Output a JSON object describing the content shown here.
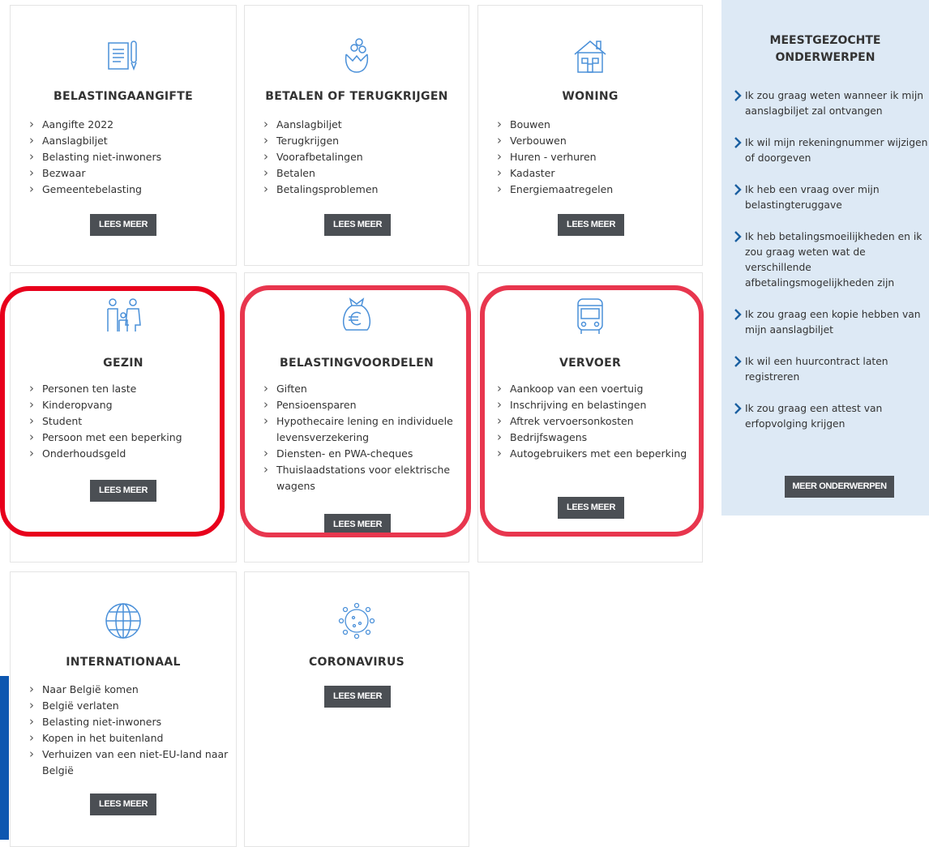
{
  "cards": [
    {
      "icon": "document-pen-icon",
      "title": "BELASTINGAANGIFTE",
      "items": [
        "Aangifte 2022",
        "Aanslagbiljet",
        "Belasting niet-inwoners",
        "Bezwaar",
        "Gemeentebelasting"
      ],
      "button": "LEES MEER"
    },
    {
      "icon": "money-bag-coins-icon",
      "title": "BETALEN OF TERUGKRIJGEN",
      "items": [
        "Aanslagbiljet",
        "Terugkrijgen",
        "Voorafbetalingen",
        "Betalen",
        "Betalingsproblemen"
      ],
      "button": "LEES MEER"
    },
    {
      "icon": "house-icon",
      "title": "WONING",
      "items": [
        "Bouwen",
        "Verbouwen",
        "Huren - verhuren",
        "Kadaster",
        "Energiemaatregelen"
      ],
      "button": "LEES MEER"
    },
    {
      "icon": "family-icon",
      "title": "GEZIN",
      "items": [
        "Personen ten laste",
        "Kinderopvang",
        "Student",
        "Persoon met een beperking",
        "Onderhoudsgeld"
      ],
      "button": "LEES MEER"
    },
    {
      "icon": "euro-bag-icon",
      "title": "BELASTINGVOORDELEN",
      "items": [
        "Giften",
        "Pensioensparen",
        "Hypothecaire lening en individuele levensverzekering",
        "Diensten- en PWA-cheques",
        "Thuislaadstations voor elektrische wagens"
      ],
      "button": "LEES MEER"
    },
    {
      "icon": "bus-icon",
      "title": "VERVOER",
      "items": [
        "Aankoop van een voertuig",
        "Inschrijving en belastingen",
        "Aftrek vervoersonkosten",
        "Bedrijfswagens",
        "Autogebruikers met een beperking"
      ],
      "button": "LEES MEER"
    },
    {
      "icon": "globe-icon",
      "title": "INTERNATIONAAL",
      "items": [
        "Naar België komen",
        "België verlaten",
        "Belasting niet-inwoners",
        "Kopen in het buitenland",
        "Verhuizen van een niet-EU-land naar België"
      ],
      "button": "LEES MEER"
    },
    {
      "icon": "virus-icon",
      "title": "CORONAVIRUS",
      "items": [],
      "button": "LEES MEER"
    }
  ],
  "sidebar": {
    "title_line1": "MEESTGEZOCHTE",
    "title_line2": "ONDERWERPEN",
    "links": [
      "Ik zou graag weten wanneer ik mijn aanslagbiljet zal ontvangen",
      "Ik wil mijn rekeningnummer wijzigen of doorgeven",
      "Ik heb een vraag over mijn belastingteruggave",
      "Ik heb betalingsmoeilijkheden en ik zou graag weten wat de verschillende afbetalingsmogelijkheden zijn",
      "Ik zou graag een kopie hebben van mijn aanslagbiljet",
      "Ik wil een huurcontract laten registreren",
      "Ik zou graag een attest van erfopvolging krijgen"
    ],
    "button": "MEER ONDERWERPEN"
  },
  "colors": {
    "icon_blue": "#4a90d9",
    "button_bg": "#4b4f54",
    "sidebar_bg": "#dde9f5",
    "chevron": "#1a5fa0",
    "highlight_red": "#e8001c",
    "highlight_pink": "#e8364e"
  }
}
